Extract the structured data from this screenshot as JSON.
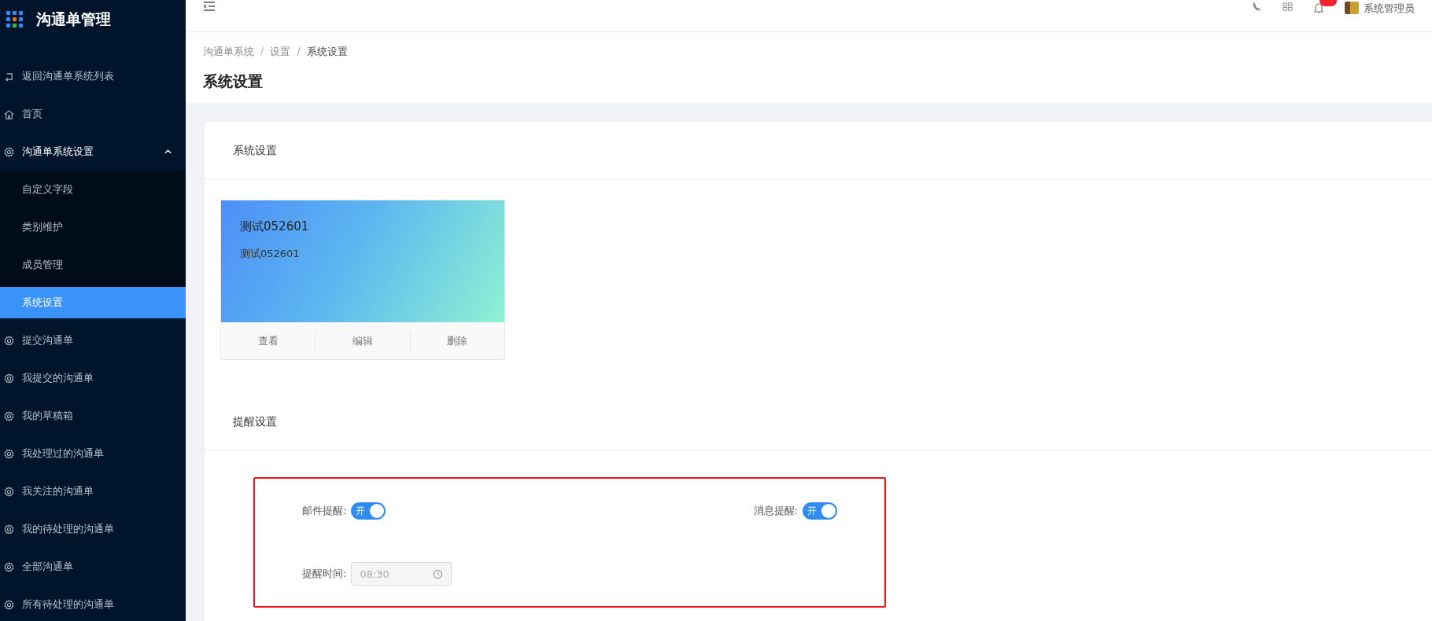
{
  "app": {
    "title": "沟通单管理"
  },
  "sidebar": {
    "items": [
      {
        "label": "返回沟通单系统列表",
        "kind": "return"
      },
      {
        "label": "首页",
        "kind": "home"
      },
      {
        "label": "沟通单系统设置",
        "kind": "group",
        "expanded": true,
        "children": [
          {
            "label": "自定义字段",
            "selected": false
          },
          {
            "label": "类别维护",
            "selected": false
          },
          {
            "label": "成员管理",
            "selected": false
          },
          {
            "label": "系统设置",
            "selected": true
          }
        ]
      },
      {
        "label": "提交沟通单",
        "kind": "page"
      },
      {
        "label": "我提交的沟通单",
        "kind": "page"
      },
      {
        "label": "我的草稿箱",
        "kind": "page"
      },
      {
        "label": "我处理过的沟通单",
        "kind": "page"
      },
      {
        "label": "我关注的沟通单",
        "kind": "page"
      },
      {
        "label": "我的待处理的沟通单",
        "kind": "page"
      },
      {
        "label": "全部沟通单",
        "kind": "page"
      },
      {
        "label": "所有待处理的沟通单",
        "kind": "page"
      }
    ]
  },
  "header": {
    "user": "系统管理员"
  },
  "breadcrumb": [
    {
      "label": "沟通单系统",
      "separator": "/"
    },
    {
      "label": "设置",
      "separator": "/"
    },
    {
      "label": "系统设置"
    }
  ],
  "page_title": "系统设置",
  "system_section": {
    "title": "系统设置",
    "card": {
      "title": "测试052601",
      "subtitle": "测试052601",
      "actions": [
        "查看",
        "编辑",
        "删除"
      ]
    }
  },
  "reminder_section": {
    "title": "提醒设置",
    "switches": [
      {
        "label": "邮件提醒:",
        "on": true,
        "text": "开"
      },
      {
        "label": "消息提醒:",
        "on": true,
        "text": "开"
      }
    ],
    "time": {
      "label": "提醒时间:",
      "value": "08:30",
      "disabled": true
    }
  }
}
